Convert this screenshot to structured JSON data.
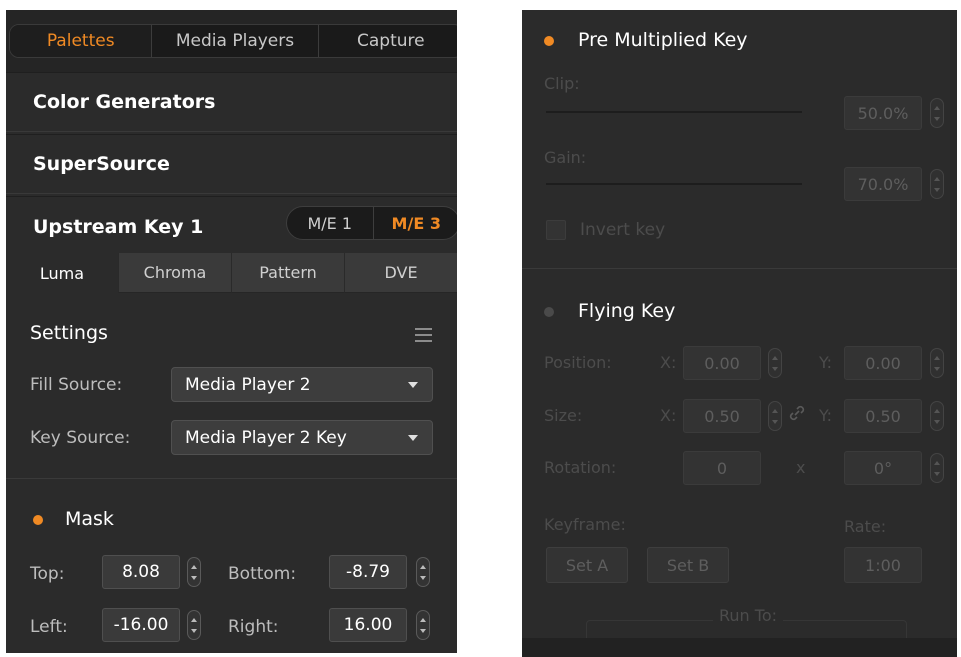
{
  "left": {
    "tabs": [
      {
        "label": "Palettes",
        "active": true
      },
      {
        "label": "Media Players",
        "active": false
      },
      {
        "label": "Capture",
        "active": false
      }
    ],
    "sections": {
      "color_generators": "Color Generators",
      "supersource": "SuperSource",
      "upstream_key": "Upstream Key 1"
    },
    "me_toggle": {
      "me1": "M/E 1",
      "me3": "M/E 3",
      "selected": "M/E 3"
    },
    "key_tabs": [
      {
        "label": "Luma",
        "active": true
      },
      {
        "label": "Chroma",
        "active": false
      },
      {
        "label": "Pattern",
        "active": false
      },
      {
        "label": "DVE",
        "active": false
      }
    ],
    "settings": {
      "title": "Settings",
      "fill_source_label": "Fill Source:",
      "fill_source_value": "Media Player 2",
      "key_source_label": "Key Source:",
      "key_source_value": "Media Player 2 Key"
    },
    "mask": {
      "label": "Mask",
      "enabled": true,
      "top_label": "Top:",
      "top_value": "8.08",
      "bottom_label": "Bottom:",
      "bottom_value": "-8.79",
      "left_label": "Left:",
      "left_value": "-16.00",
      "right_label": "Right:",
      "right_value": "16.00"
    }
  },
  "right": {
    "premultiplied": {
      "label": "Pre Multiplied Key",
      "enabled": true,
      "clip_label": "Clip:",
      "clip_value": "50.0%",
      "gain_label": "Gain:",
      "gain_value": "70.0%",
      "invert_label": "Invert key"
    },
    "flying": {
      "label": "Flying Key",
      "enabled": false,
      "position_label": "Position:",
      "size_label": "Size:",
      "rotation_label": "Rotation:",
      "x_label": "X:",
      "y_label": "Y:",
      "x_sep": "x",
      "position_x": "0.00",
      "position_y": "0.00",
      "size_x": "0.50",
      "size_y": "0.50",
      "rotation_turns": "0",
      "rotation_degrees": "0°",
      "keyframe_label": "Keyframe:",
      "rate_label": "Rate:",
      "set_a": "Set A",
      "set_b": "Set B",
      "rate_value": "1:00",
      "run_to_label": "Run To:"
    }
  },
  "colors": {
    "accent": "#f08a24",
    "panel": "#2b2b2b"
  }
}
